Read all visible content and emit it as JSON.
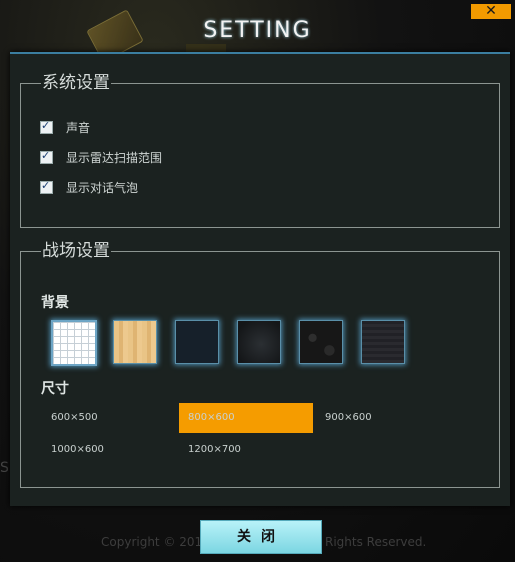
{
  "window": {
    "title": "SETTING",
    "close_glyph": "✕"
  },
  "system_group": {
    "legend": "系统设置",
    "options": [
      {
        "label": "声音",
        "checked": true
      },
      {
        "label": "显示雷达扫描范围",
        "checked": true
      },
      {
        "label": "显示对话气泡",
        "checked": true
      }
    ]
  },
  "battle_group": {
    "legend": "战场设置",
    "background_label": "背景",
    "backgrounds": [
      {
        "name": "white-grid"
      },
      {
        "name": "wood"
      },
      {
        "name": "dark-blue"
      },
      {
        "name": "dark-gray"
      },
      {
        "name": "dark-rock"
      },
      {
        "name": "dark-stripes"
      }
    ],
    "size_label": "尺寸",
    "sizes": [
      "600×500",
      "800×600",
      "900×600",
      "1000×600",
      "1200×700"
    ],
    "selected_size": "800×600"
  },
  "footer": {
    "close_button": "关闭",
    "copyright_left": "Copyright © 2012",
    "copyright_right": "Rights Reserved."
  },
  "colors": {
    "accent": "#f59c00",
    "button": "#7cd6e2",
    "panel": "#1b2220"
  }
}
